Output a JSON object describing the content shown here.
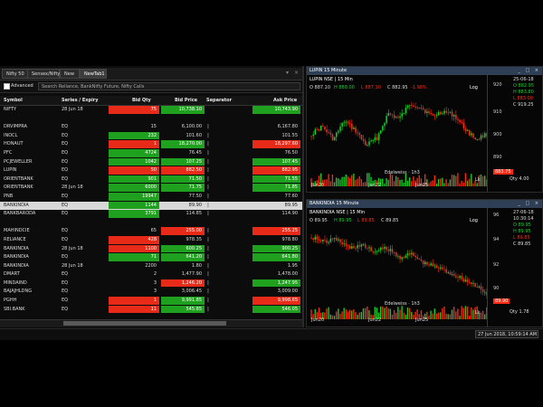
{
  "tabs": [
    {
      "label": "Nifty 50",
      "active": false
    },
    {
      "label": "Sensex/Nifty",
      "active": false
    },
    {
      "label": "New",
      "active": false
    },
    {
      "label": "NewTab1",
      "active": true
    }
  ],
  "advanced_label": "Advanced",
  "search_value": "Search Reliance, BankNifty Future, Nifty Calls",
  "columns": {
    "symbol": "Symbol",
    "series": "Series / Expiry",
    "bid_qty": "Bid Qty",
    "bid_price": "Bid Price",
    "separator": "Separator",
    "ask_price": "Ask Price"
  },
  "rows": [
    {
      "sym": "NIFTY",
      "ser": "28 Jun 18",
      "bq": "75",
      "bqc": "red",
      "bp": "10,738.10",
      "bpc": "green",
      "sep": "",
      "ap": "10,743.90",
      "apc": "green"
    },
    {
      "sym": "",
      "ser": "",
      "bq": "",
      "bqc": "",
      "bp": "",
      "bpc": "",
      "sep": "",
      "ap": "",
      "apc": ""
    },
    {
      "sym": "DRVIMPRA",
      "ser": "EQ",
      "bq": "15",
      "bqc": "",
      "bp": "6,100.00",
      "bpc": "",
      "sep": "|",
      "ap": "6,167.80",
      "apc": ""
    },
    {
      "sym": "INOCL",
      "ser": "EQ",
      "bq": "232",
      "bqc": "green",
      "bp": "101.60",
      "bpc": "",
      "sep": "|",
      "ap": "101.55",
      "apc": ""
    },
    {
      "sym": "HONAUT",
      "ser": "EQ",
      "bq": "1",
      "bqc": "red",
      "bp": "18,270.00",
      "bpc": "green",
      "sep": "|",
      "ap": "18,297.60",
      "apc": "red"
    },
    {
      "sym": "PFC",
      "ser": "EQ",
      "bq": "4724",
      "bqc": "green",
      "bp": "76.45",
      "bpc": "",
      "sep": "|",
      "ap": "76.50",
      "apc": ""
    },
    {
      "sym": "PCJEWELLER",
      "ser": "EQ",
      "bq": "1042",
      "bqc": "green",
      "bp": "107.25",
      "bpc": "green",
      "sep": "|",
      "ap": "107.45",
      "apc": "green"
    },
    {
      "sym": "LUPIN",
      "ser": "EQ",
      "bq": "50",
      "bqc": "red",
      "bp": "882.50",
      "bpc": "red",
      "sep": "|",
      "ap": "882.95",
      "apc": "red"
    },
    {
      "sym": "ORIENTBANK",
      "ser": "EQ",
      "bq": "901",
      "bqc": "green",
      "bp": "71.50",
      "bpc": "green",
      "sep": "|",
      "ap": "71.55",
      "apc": "green"
    },
    {
      "sym": "ORIENTBANK",
      "ser": "28 Jun 18",
      "bq": "6000",
      "bqc": "green",
      "bp": "71.75",
      "bpc": "green",
      "sep": "|",
      "ap": "71.85",
      "apc": "green"
    },
    {
      "sym": "PNB",
      "ser": "EQ",
      "bq": "19947",
      "bqc": "green",
      "bp": "77.50",
      "bpc": "",
      "sep": "|",
      "ap": "77.60",
      "apc": ""
    },
    {
      "sym": "BANKINDIA",
      "ser": "EQ",
      "bq": "1144",
      "bqc": "green",
      "bp": "89.90",
      "bpc": "",
      "sep": "|",
      "ap": "89.95",
      "apc": "",
      "sel": true
    },
    {
      "sym": "BANKBARODA",
      "ser": "EQ",
      "bq": "3791",
      "bqc": "green",
      "bp": "114.85",
      "bpc": "",
      "sep": "|",
      "ap": "114.90",
      "apc": ""
    },
    {
      "sym": "",
      "ser": "",
      "bq": "",
      "bqc": "",
      "bp": "",
      "bpc": "",
      "sep": "",
      "ap": "",
      "apc": ""
    },
    {
      "sym": "MAHINDCIE",
      "ser": "EQ",
      "bq": "65",
      "bqc": "",
      "bp": "255.00",
      "bpc": "red",
      "sep": "|",
      "ap": "255.25",
      "apc": "red"
    },
    {
      "sym": "RELIANCE",
      "ser": "EQ",
      "bq": "428",
      "bqc": "red",
      "bp": "978.35",
      "bpc": "",
      "sep": "|",
      "ap": "978.80",
      "apc": ""
    },
    {
      "sym": "BANKINDIA",
      "ser": "28 Jun 18",
      "bq": "1100",
      "bqc": "red",
      "bp": "600.25",
      "bpc": "green",
      "sep": "|",
      "ap": "900.25",
      "apc": "green"
    },
    {
      "sym": "BANKINDIA",
      "ser": "EQ",
      "bq": "71",
      "bqc": "green",
      "bp": "641.20",
      "bpc": "green",
      "sep": "|",
      "ap": "641.80",
      "apc": "green"
    },
    {
      "sym": "BANKINDIA",
      "ser": "28 Jun 18",
      "bq": "2200",
      "bqc": "",
      "bp": "1.80",
      "bpc": "",
      "sep": "|",
      "ap": "1.95",
      "apc": ""
    },
    {
      "sym": "DMART",
      "ser": "EQ",
      "bq": "2",
      "bqc": "",
      "bp": "1,477.90",
      "bpc": "",
      "sep": "|",
      "ap": "1,478.00",
      "apc": ""
    },
    {
      "sym": "MINDAIND",
      "ser": "EQ",
      "bq": "3",
      "bqc": "",
      "bp": "1,246.20",
      "bpc": "red",
      "sep": "|",
      "ap": "1,247.95",
      "apc": "green"
    },
    {
      "sym": "BAJAJHLDNG",
      "ser": "EQ",
      "bq": "3",
      "bqc": "",
      "bp": "3,006.45",
      "bpc": "",
      "sep": "|",
      "ap": "3,009.00",
      "apc": ""
    },
    {
      "sym": "PGHH",
      "ser": "EQ",
      "bq": "1",
      "bqc": "red",
      "bp": "9,991.85",
      "bpc": "green",
      "sep": "|",
      "ap": "9,998.65",
      "apc": "red"
    },
    {
      "sym": "SBI.BANK",
      "ser": "EQ",
      "bq": "11",
      "bqc": "red",
      "bp": "545.85",
      "bpc": "green",
      "sep": "|",
      "ap": "546.05",
      "apc": "green"
    }
  ],
  "chart1": {
    "title": "LUPIN 15 Minute",
    "symbol": "LUPIN NSE | 15 Min",
    "o": "O 887.10",
    "h": "H 888.00",
    "l": "L 887.10",
    "c": "C 882.95",
    "chg": "-1.98%",
    "log": "Log",
    "info": [
      "25-06-18",
      "O 882.95",
      "H 883.80",
      "L 883.00",
      "C 919.25"
    ],
    "ticks": [
      "920",
      "910",
      "900",
      "890"
    ],
    "current": "883.75",
    "qty": "Qty 4.00",
    "xlabels": [
      "Jun20",
      "Jun22",
      "Jun25"
    ],
    "edelweiss": "Edelweiss · 1h3",
    "lk": "Lk"
  },
  "chart2": {
    "title": "BANKINDIA 15 Minute",
    "symbol": "BANKINDIA NSE | 15 Min",
    "o": "O 89.95",
    "h": "H 89.95",
    "l": "L 89.85",
    "c": "C 89.85",
    "chg": "",
    "log": "Log",
    "info": [
      "27-06-18",
      "10:30:14",
      "O 89.95",
      "H 89.95",
      "L 89.85",
      "C 89.85"
    ],
    "ticks": [
      "96",
      "94",
      "92",
      "90"
    ],
    "current": "89.90",
    "qty": "Qty 1.78",
    "xlabels": [
      "Jun20",
      "Jun22",
      "Jun25"
    ],
    "edelweiss": "Edelweiss · 1h3",
    "lk": "Lk"
  },
  "clock": "27 Jun 2018, 10:59:14 AM",
  "colors": {
    "up": "#16d12a",
    "down": "#ff2a14",
    "sel": "#d8d8d8"
  }
}
